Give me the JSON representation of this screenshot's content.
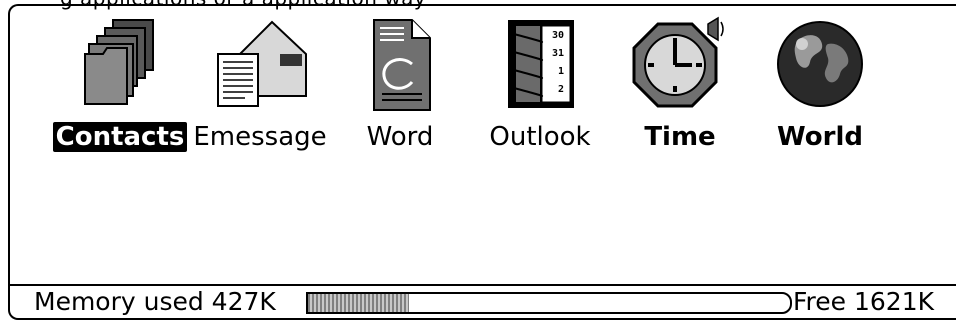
{
  "top_caption": "g applications or a application way",
  "apps": [
    {
      "label": "Contacts",
      "icon": "contacts-stack-icon",
      "selected": true
    },
    {
      "label": "Emessage",
      "icon": "envelope-document-icon",
      "selected": false
    },
    {
      "label": "Word",
      "icon": "word-document-icon",
      "selected": false
    },
    {
      "label": "Outlook",
      "icon": "calendar-book-icon",
      "selected": false
    },
    {
      "label": "Time",
      "icon": "clock-speaker-icon",
      "selected": false
    },
    {
      "label": "World",
      "icon": "globe-icon",
      "selected": false
    }
  ],
  "more_indicator": "+",
  "status": {
    "memory_used": "Memory used 427K",
    "free": "Free 1621K",
    "usage_fraction": 0.21
  }
}
